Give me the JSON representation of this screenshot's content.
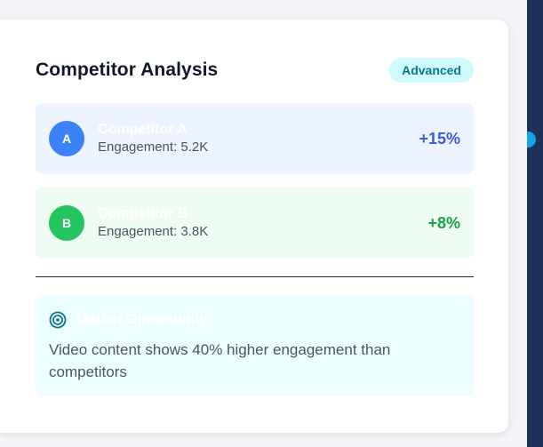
{
  "header": {
    "title": "Competitor Analysis",
    "badge": "Advanced"
  },
  "competitors": [
    {
      "initial": "A",
      "name": "Competitor A",
      "engagement": "Engagement: 5.2K",
      "change": "+15%",
      "color": "#3b82f6"
    },
    {
      "initial": "B",
      "name": "Competitor B",
      "engagement": "Engagement: 3.8K",
      "change": "+8%",
      "color": "#22c55e"
    }
  ],
  "opportunity": {
    "icon": "target-icon",
    "title": "Market Opportunity",
    "text": "Video content shows 40% higher engagement than competitors"
  },
  "colors": {
    "accent": "#0e7490",
    "badge_bg": "#cffafe"
  }
}
